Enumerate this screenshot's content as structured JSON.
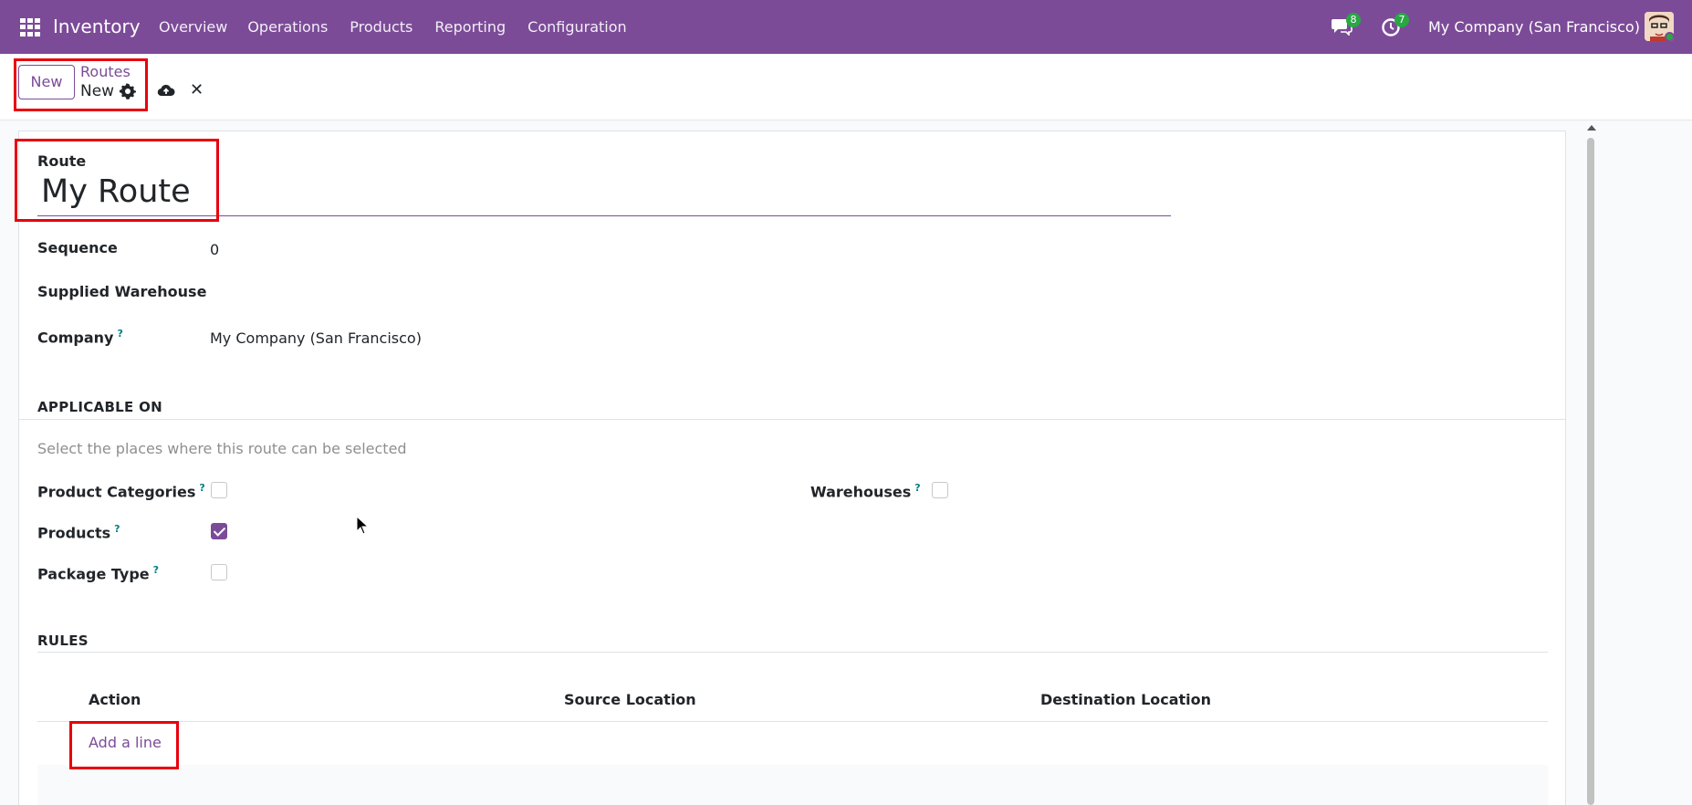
{
  "navbar": {
    "app_name": "Inventory",
    "menu": [
      "Overview",
      "Operations",
      "Products",
      "Reporting",
      "Configuration"
    ],
    "messages_count": "8",
    "activities_count": "7",
    "company": "My Company (San Francisco)"
  },
  "control_panel": {
    "new_button": "New",
    "breadcrumb_parent": "Routes",
    "breadcrumb_current": "New"
  },
  "form": {
    "route_label": "Route",
    "route_value": "My Route",
    "sequence_label": "Sequence",
    "sequence_value": "0",
    "supplied_warehouse_label": "Supplied Warehouse",
    "company_label": "Company",
    "company_value": "My Company (San Francisco)",
    "tooltip_mark": "?"
  },
  "applicable_on": {
    "title": "APPLICABLE ON",
    "help": "Select the places where this route can be selected",
    "product_categories_label": "Product Categories",
    "product_categories_checked": false,
    "products_label": "Products",
    "products_checked": true,
    "package_type_label": "Package Type",
    "package_type_checked": false,
    "warehouses_label": "Warehouses",
    "warehouses_checked": false
  },
  "rules": {
    "title": "RULES",
    "columns": [
      "Action",
      "Source Location",
      "Destination Location"
    ],
    "add_line": "Add a line"
  },
  "colors": {
    "brand": "#7c4b98",
    "highlight": "#e8000d",
    "badge": "#28a745"
  }
}
